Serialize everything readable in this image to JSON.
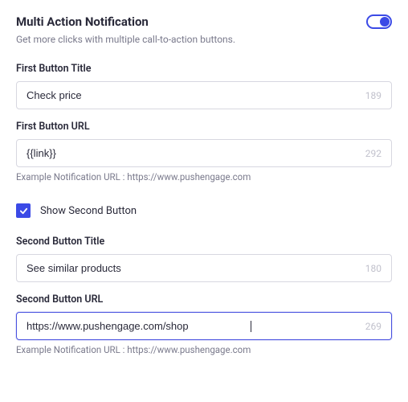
{
  "header": {
    "title": "Multi Action Notification",
    "subtitle": "Get more clicks with multiple call-to-action buttons.",
    "toggle_on": true
  },
  "first_button": {
    "title_label": "First Button Title",
    "title_value": "Check price",
    "title_limit": "189",
    "url_label": "First Button URL",
    "url_value": "{{link}}",
    "url_limit": "292",
    "url_helper": "Example Notification URL : https://www.pushengage.com"
  },
  "second_toggle": {
    "label": "Show Second Button",
    "checked": true
  },
  "second_button": {
    "title_label": "Second Button Title",
    "title_value": "See similar products",
    "title_limit": "180",
    "url_label": "Second Button URL",
    "url_value": "https://www.pushengage.com/shop",
    "url_limit": "269",
    "url_helper": "Example Notification URL : https://www.pushengage.com"
  }
}
